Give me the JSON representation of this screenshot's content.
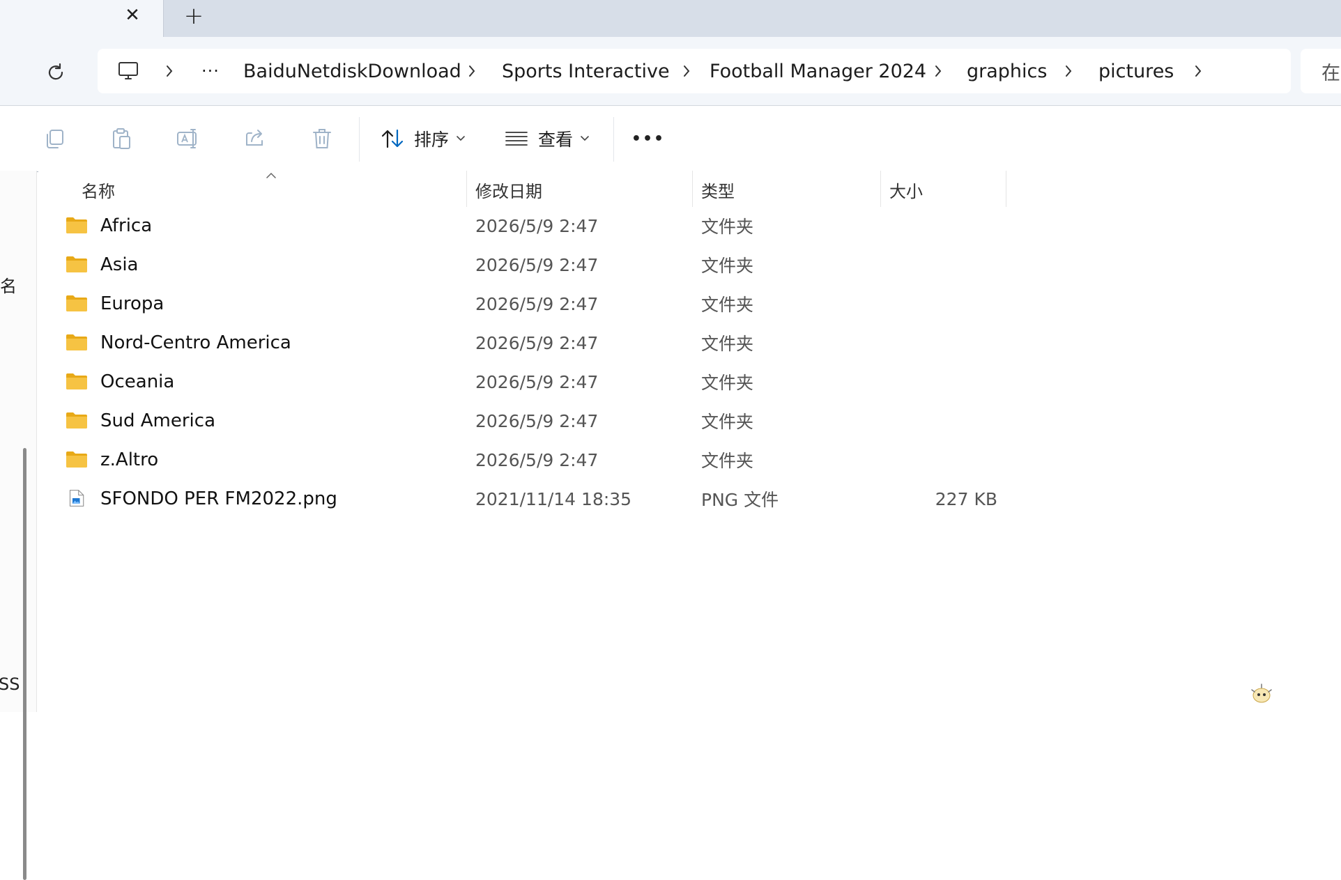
{
  "tabs": {
    "close_glyph": "✕",
    "new_glyph": "+"
  },
  "breadcrumb": {
    "overflow": "···",
    "items": [
      "BaiduNetdiskDownload",
      "Sports Interactive",
      "Football Manager 2024",
      "graphics",
      "pictures"
    ]
  },
  "search": {
    "partial_text": "在"
  },
  "toolbar": {
    "sort_label": "排序",
    "view_label": "查看",
    "more_glyph": "•••"
  },
  "nav": {
    "fragment_top": "名",
    "fragment_bottom": "SS"
  },
  "columns": {
    "name": "名称",
    "modified": "修改日期",
    "type": "类型",
    "size": "大小",
    "sort_glyph": "^"
  },
  "files": [
    {
      "name": "Africa",
      "modified": "2026/5/9 2:47",
      "type": "文件夹",
      "size": "",
      "icon": "folder-icon"
    },
    {
      "name": "Asia",
      "modified": "2026/5/9 2:47",
      "type": "文件夹",
      "size": "",
      "icon": "folder-icon"
    },
    {
      "name": "Europa",
      "modified": "2026/5/9 2:47",
      "type": "文件夹",
      "size": "",
      "icon": "folder-icon"
    },
    {
      "name": "Nord-Centro America",
      "modified": "2026/5/9 2:47",
      "type": "文件夹",
      "size": "",
      "icon": "folder-icon"
    },
    {
      "name": "Oceania",
      "modified": "2026/5/9 2:47",
      "type": "文件夹",
      "size": "",
      "icon": "folder-icon"
    },
    {
      "name": "Sud America",
      "modified": "2026/5/9 2:47",
      "type": "文件夹",
      "size": "",
      "icon": "folder-icon"
    },
    {
      "name": "z.Altro",
      "modified": "2026/5/9 2:47",
      "type": "文件夹",
      "size": "",
      "icon": "folder-icon"
    },
    {
      "name": "SFONDO PER FM2022.png",
      "modified": "2021/11/14 18:35",
      "type": "PNG 文件",
      "size": "227 KB",
      "icon": "png-file-icon"
    }
  ],
  "colors": {
    "folder": "#f6c343",
    "folder_dark": "#e8a917",
    "accent": "#0067c0",
    "chrome": "#f3f6fa",
    "tabstrip": "#d7dee8"
  }
}
